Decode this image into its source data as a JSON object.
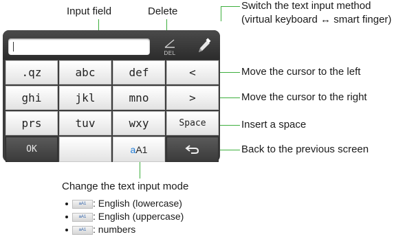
{
  "callouts": {
    "input_field": "Input field",
    "delete": "Delete",
    "switch_method_1": "Switch the text input method",
    "switch_method_2": "(virtual keyboard ↔ smart finger)",
    "cursor_left": "Move the cursor to the left",
    "cursor_right": "Move the cursor to the right",
    "insert_space": "Insert a space",
    "back": "Back to the previous screen",
    "change_mode": "Change the text input mode"
  },
  "device": {
    "input_value": "",
    "delete_label": "DEL",
    "delete_icon": "backspace-arrow-icon",
    "switch_icon": "pencil-icon"
  },
  "keys": {
    "row1": [
      ".qz",
      "abc",
      "def",
      "<"
    ],
    "row2": [
      "ghi",
      "jkl",
      "mno",
      ">"
    ],
    "row3": [
      "prs",
      "tuv",
      "wxy",
      "Space"
    ],
    "row4": [
      "OK",
      "",
      "aA1",
      "back-icon"
    ]
  },
  "mode_key": {
    "lower": "a",
    "upper_num": "A1"
  },
  "mode_list": [
    {
      "chip": "aA1",
      "text": ": English (lowercase)"
    },
    {
      "chip": "aA1",
      "text": ": English (uppercase)"
    },
    {
      "chip": "aA1",
      "text": ": numbers"
    }
  ],
  "colors": {
    "callout_line": "#3cae3c",
    "accent_blue": "#1f7bd6",
    "device_dark": "#3d3d3d"
  }
}
